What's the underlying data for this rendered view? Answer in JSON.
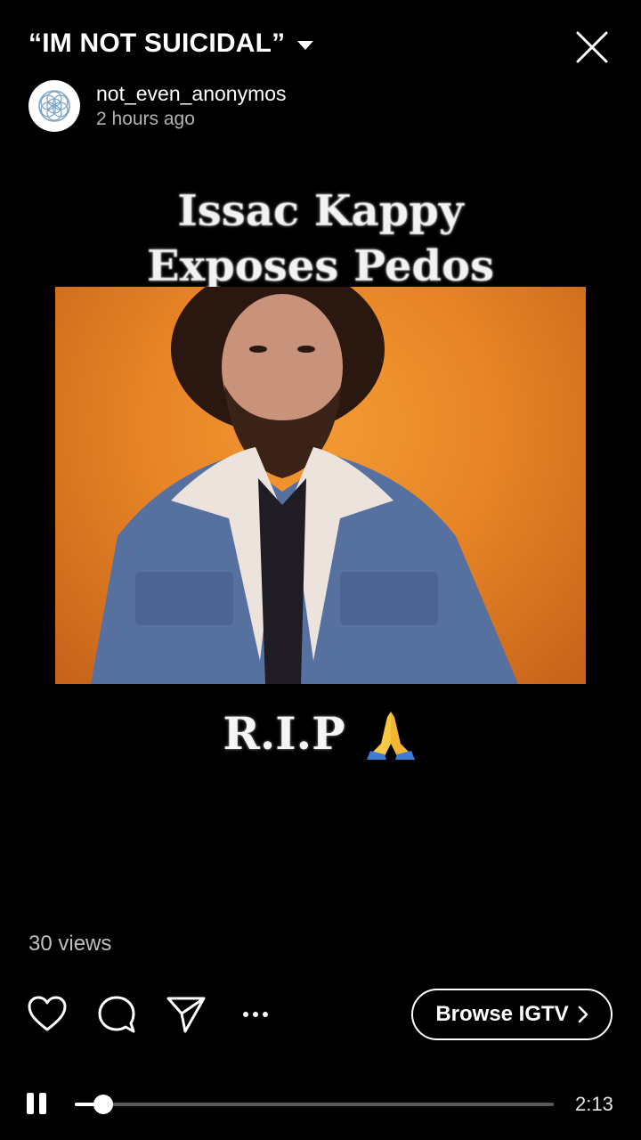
{
  "header": {
    "title": "“IM NOT SUICIDAL”",
    "dropdown_icon": "caret-down-icon",
    "close_icon": "close-icon"
  },
  "author": {
    "username": "not_even_anonymos",
    "posted": "2 hours ago",
    "avatar_icon": "flower-of-life-icon"
  },
  "video": {
    "headline_line1": "Issac Kappy",
    "headline_line2": "Exposes Pedos",
    "caption": "R.I.P",
    "caption_emoji_icon": "folded-hands-icon",
    "background_color": "#e88526"
  },
  "stats": {
    "views": "30 views"
  },
  "actions": {
    "like_icon": "heart-icon",
    "comment_icon": "comment-icon",
    "share_icon": "paper-plane-icon",
    "more_icon": "more-dots-icon",
    "browse_label": "Browse IGTV",
    "browse_chevron": "›"
  },
  "player": {
    "state_icon": "pause-icon",
    "progress_fraction": 0.06,
    "duration": "2:13"
  }
}
